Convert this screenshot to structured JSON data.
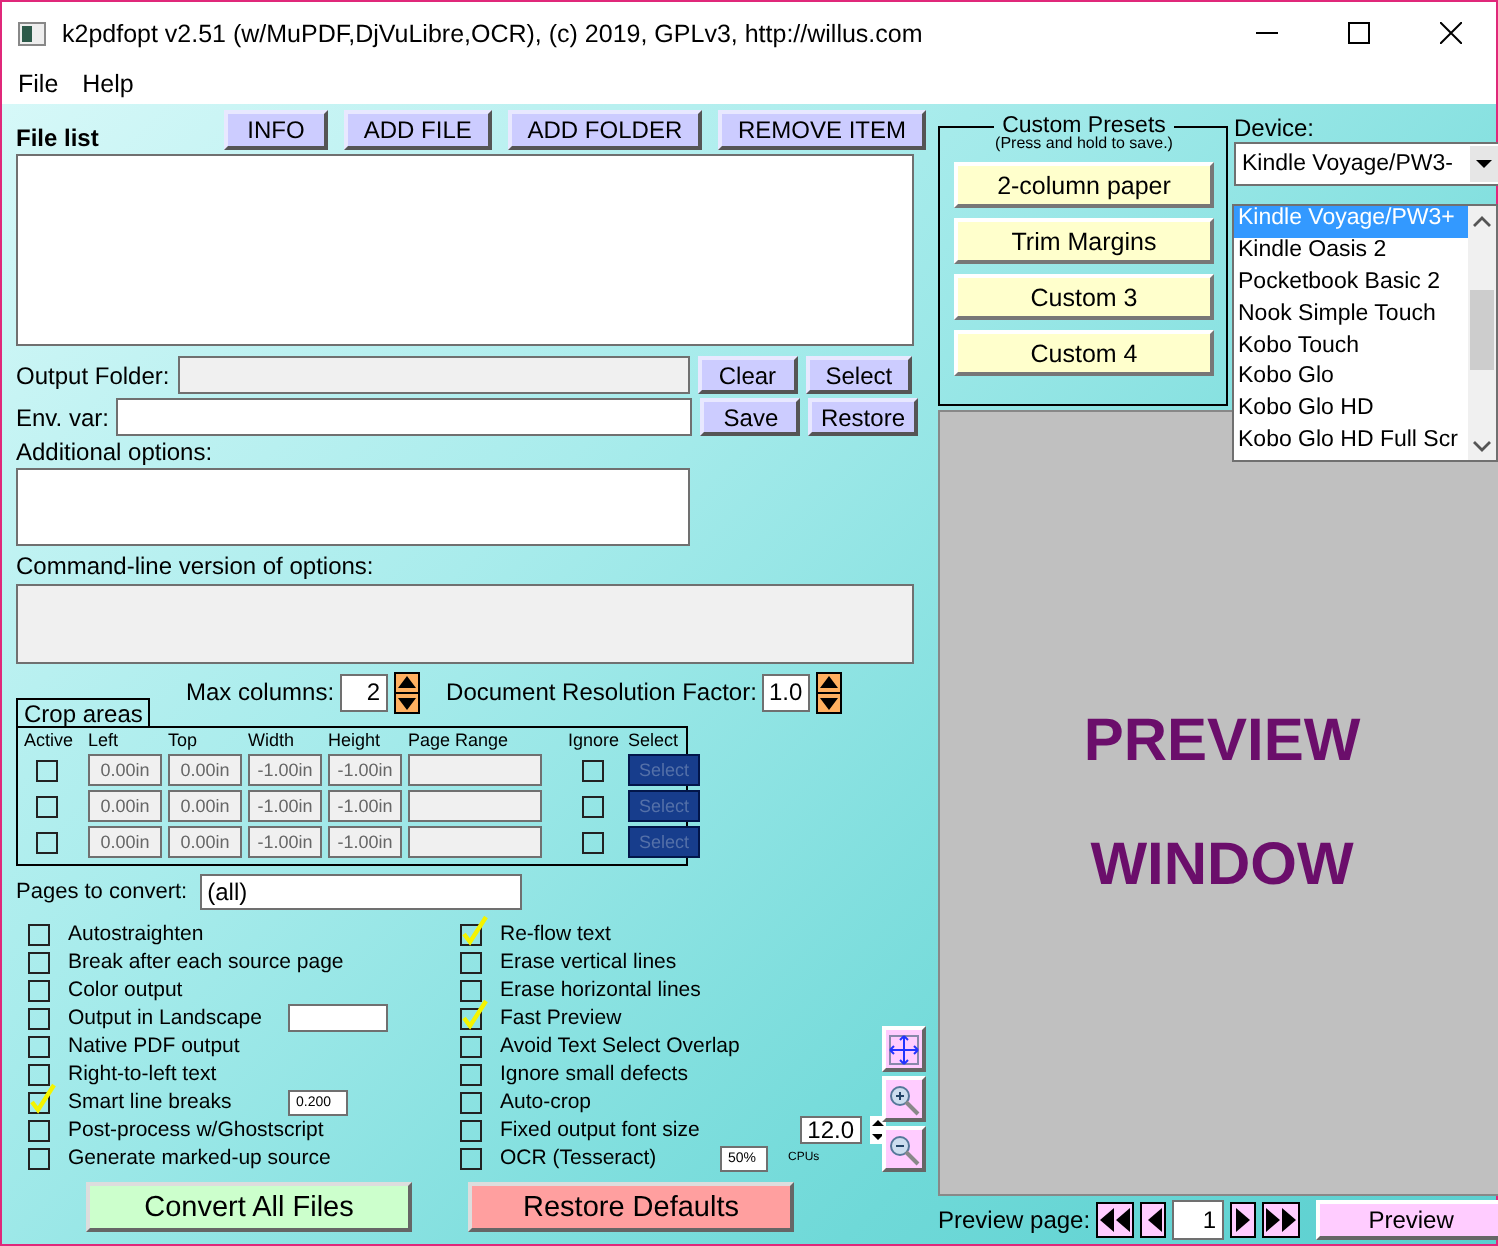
{
  "window": {
    "title": "k2pdfopt v2.51 (w/MuPDF,DjVuLibre,OCR), (c) 2019, GPLv3, http://willus.com"
  },
  "menu": [
    "File",
    "Help"
  ],
  "file_list": {
    "label": "File list",
    "buttons": [
      "INFO",
      "ADD FILE",
      "ADD FOLDER",
      "REMOVE ITEM"
    ]
  },
  "output_folder": {
    "label": "Output Folder:",
    "buttons": [
      "Clear",
      "Select"
    ]
  },
  "env_var": {
    "label": "Env. var:",
    "buttons": [
      "Save",
      "Restore"
    ]
  },
  "additional_options": {
    "label": "Additional options:"
  },
  "command_line": {
    "label": "Command-line version of options:"
  },
  "max_columns": {
    "label": "Max columns:",
    "value": "2"
  },
  "resolution": {
    "label": "Document Resolution Factor:",
    "value": "1.0"
  },
  "crop_areas": {
    "title": "Crop areas",
    "columns": [
      "Active",
      "Left",
      "Top",
      "Width",
      "Height",
      "Page Range",
      "Ignore",
      "Select"
    ],
    "rows": [
      {
        "active": false,
        "left": "0.00in",
        "top": "0.00in",
        "width": "-1.00in",
        "height": "-1.00in",
        "ignore": false,
        "button": "Select"
      },
      {
        "active": false,
        "left": "0.00in",
        "top": "0.00in",
        "width": "-1.00in",
        "height": "-1.00in",
        "ignore": false,
        "button": "Select"
      },
      {
        "active": false,
        "left": "0.00in",
        "top": "0.00in",
        "width": "-1.00in",
        "height": "-1.00in",
        "ignore": false,
        "button": "Select"
      }
    ]
  },
  "pages_to_convert": {
    "label": "Pages to convert:",
    "value": "(all)"
  },
  "options_left": [
    {
      "kind": "check",
      "label": "Autostraighten",
      "checked": false
    },
    {
      "kind": "check",
      "label": "Break after each source page",
      "checked": false
    },
    {
      "kind": "check",
      "label": "Color output",
      "checked": false
    },
    {
      "kind": "field",
      "label": "Output in Landscape",
      "checked": false
    },
    {
      "kind": "check",
      "label": "Native PDF output",
      "checked": false
    },
    {
      "kind": "check",
      "label": "Right-to-left text",
      "checked": false
    },
    {
      "kind": "field",
      "label": "Smart line breaks",
      "checked": true,
      "value": "0.200"
    },
    {
      "kind": "check",
      "label": "Post-process w/Ghostscript",
      "checked": false
    },
    {
      "kind": "check",
      "label": "Generate marked-up source",
      "checked": false
    }
  ],
  "options_right": [
    {
      "kind": "check",
      "label": "Re-flow text",
      "checked": true
    },
    {
      "kind": "check",
      "label": "Erase vertical lines",
      "checked": false
    },
    {
      "kind": "check",
      "label": "Erase horizontal lines",
      "checked": false
    },
    {
      "kind": "check",
      "label": "Fast Preview",
      "checked": true
    },
    {
      "kind": "check",
      "label": "Avoid Text Select Overlap",
      "checked": false
    },
    {
      "kind": "check",
      "label": "Ignore small defects",
      "checked": false
    },
    {
      "kind": "check",
      "label": "Auto-crop",
      "checked": false
    },
    {
      "kind": "spinner",
      "label": "Fixed output font size",
      "checked": false,
      "value": "12.0"
    },
    {
      "kind": "field",
      "label": "OCR (Tesseract)",
      "checked": false,
      "value": "50%",
      "suffix": "CPUs"
    }
  ],
  "actions": [
    {
      "kind": "convert",
      "label": "Convert All Files"
    },
    {
      "kind": "reset",
      "label": "Restore Defaults"
    }
  ],
  "presets": {
    "title": "Custom Presets",
    "hint": "(Press and hold to save.)",
    "buttons": [
      "2-column paper",
      "Trim Margins",
      "Custom 3",
      "Custom 4"
    ]
  },
  "device": {
    "label": "Device:",
    "value": "Kindle Voyage/PW3-",
    "options": [
      {
        "label": "Kindle Voyage/PW3+",
        "selected": true
      },
      {
        "label": "Kindle Oasis 2",
        "selected": false
      },
      {
        "label": "Pocketbook Basic 2",
        "selected": false
      },
      {
        "label": "Nook Simple Touch",
        "selected": false
      },
      {
        "label": "Kobo Touch",
        "selected": false
      },
      {
        "label": "Kobo Glo",
        "selected": false
      },
      {
        "label": "Kobo Glo HD",
        "selected": false
      },
      {
        "label": "Kobo Glo HD Full Scr",
        "selected": false
      }
    ]
  },
  "preview": {
    "lines": [
      "PREVIEW",
      "WINDOW"
    ],
    "page_label": "Preview page:",
    "page": "1",
    "button": "Preview"
  }
}
